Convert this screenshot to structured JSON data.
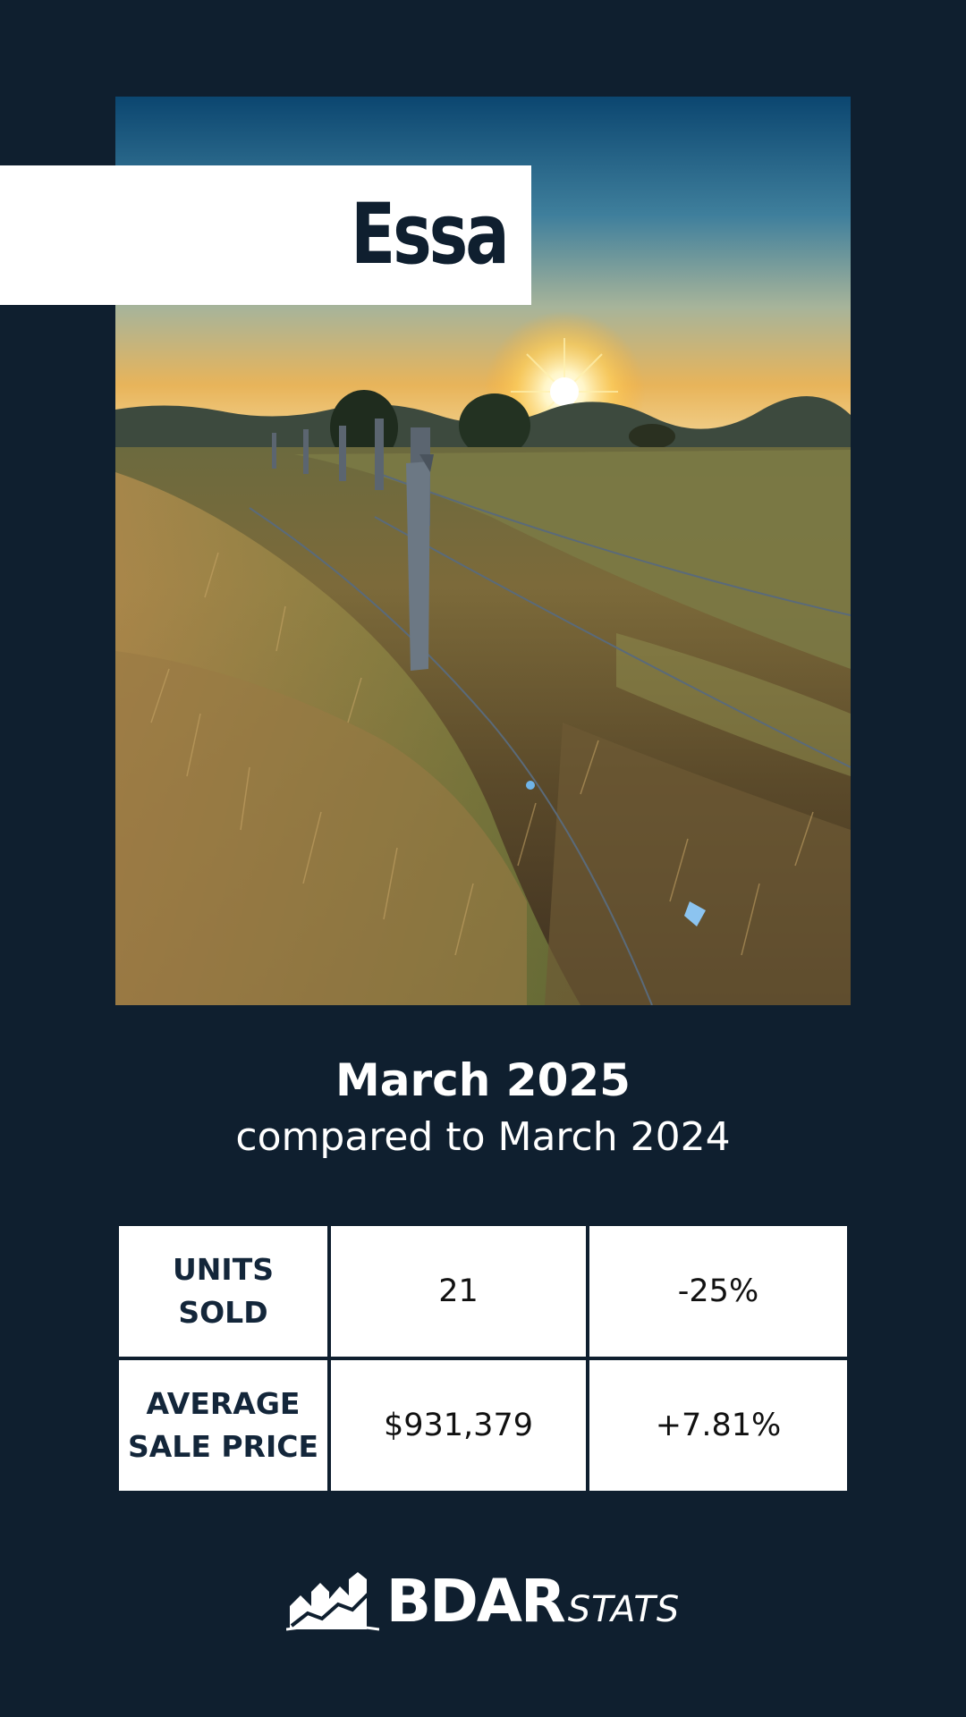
{
  "title": "Essa",
  "period": {
    "month": "March 2025",
    "comparison": "compared to March 2024"
  },
  "stats": [
    {
      "label": "UNITS\nSOLD",
      "value": "21",
      "change": "-25%"
    },
    {
      "label": "AVERAGE\nSALE PRICE",
      "value": "$931,379",
      "change": "+7.81%"
    }
  ],
  "logo": {
    "brand": "BDAR",
    "suffix": "STATS",
    "icon": "house-chart-icon"
  },
  "colors": {
    "background": "#0f1f2f",
    "panel": "#ffffff",
    "accent_text": "#0f1f2f"
  }
}
